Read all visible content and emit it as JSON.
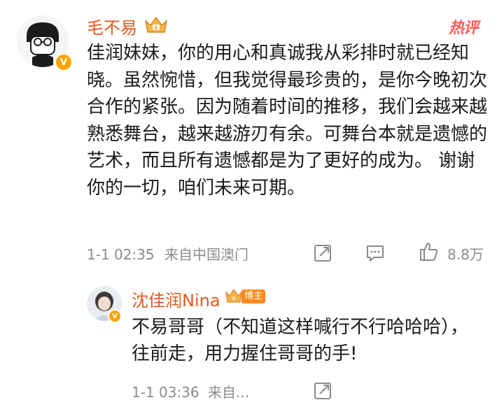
{
  "main_comment": {
    "username": "毛不易",
    "hot_label": "热评",
    "text": "佳润妹妹，你的用心和真诚我从彩排时就已经知晓。虽然惋惜，但我觉得最珍贵的，是你今晚初次合作的紧张。因为随着时间的推移，我们会越来越熟悉舞台，越来越游刃有余。可舞台本就是遗憾的艺术，而且所有遗憾都是为了更好的成为。 谢谢你的一切，咱们未来可期。",
    "timestamp": "1-1 02:35",
    "location": "来自中国澳门",
    "like_count": "8.8万",
    "icons": [
      "share-icon",
      "comment-icon",
      "like-icon"
    ],
    "verified_color": "#ffa200"
  },
  "reply": {
    "username": "沈佳润Nina",
    "badge_label": "博主",
    "text": "不易哥哥（不知道这样喊行不行哈哈哈），往前走，用力握住哥哥的手!",
    "timestamp": "1-1 03:36",
    "location": "来自...",
    "icons": [
      "share-icon"
    ]
  },
  "colors": {
    "username": "#e2591b",
    "meta": "#8b8b8b",
    "hot": "#ff5a5a"
  }
}
